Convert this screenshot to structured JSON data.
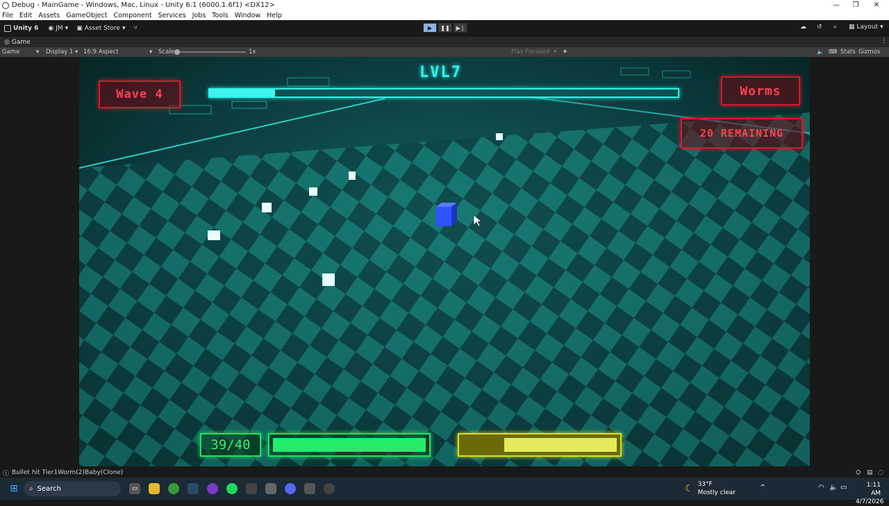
{
  "window": {
    "title": "Debug - MainGame - Windows, Mac, Linux - Unity 6.1 (6000.1.6f1) <DX12>",
    "minimize": "—",
    "restore": "❐",
    "close": "✕"
  },
  "menu": [
    "File",
    "Edit",
    "Assets",
    "GameObject",
    "Component",
    "Services",
    "Jobs",
    "Tools",
    "Window",
    "Help"
  ],
  "toolbar": {
    "unity_label": "Unity 6",
    "account": "JM",
    "asset_store": "Asset Store",
    "layout": "Layout"
  },
  "play_controls": {
    "play": "▶",
    "pause": "❚❚",
    "step": "▶❘"
  },
  "tabs": {
    "game": "Game"
  },
  "game_bar": {
    "display_mode": "Game",
    "display": "Display 1",
    "aspect": "16:9 Aspect",
    "scale_label": "Scale",
    "scale_value": "1x",
    "play_focused": "Play Focused",
    "stats": "Stats",
    "gizmos": "Gizmos"
  },
  "hud": {
    "wave": "Wave 4",
    "level": "LVL7",
    "enemy_type": "Worms",
    "remaining": "20 REMAINING",
    "ammo": "39/40",
    "xp_fraction": 0.14,
    "health_fraction": 1.0,
    "stamina_fraction": 0.73
  },
  "status": {
    "message": "Bullet hit Tier1Worm(2)Baby(Clone)"
  },
  "taskbar": {
    "search": "Search",
    "weather_temp": "33°F",
    "weather_desc": "Mostly clear",
    "time": "1:11 AM",
    "date": "4/7/2026"
  },
  "colors": {
    "accent_teal": "#1fd6d0",
    "hud_red": "#d01a2a",
    "hud_green": "#20e060",
    "hud_yellow": "#d8e020"
  }
}
